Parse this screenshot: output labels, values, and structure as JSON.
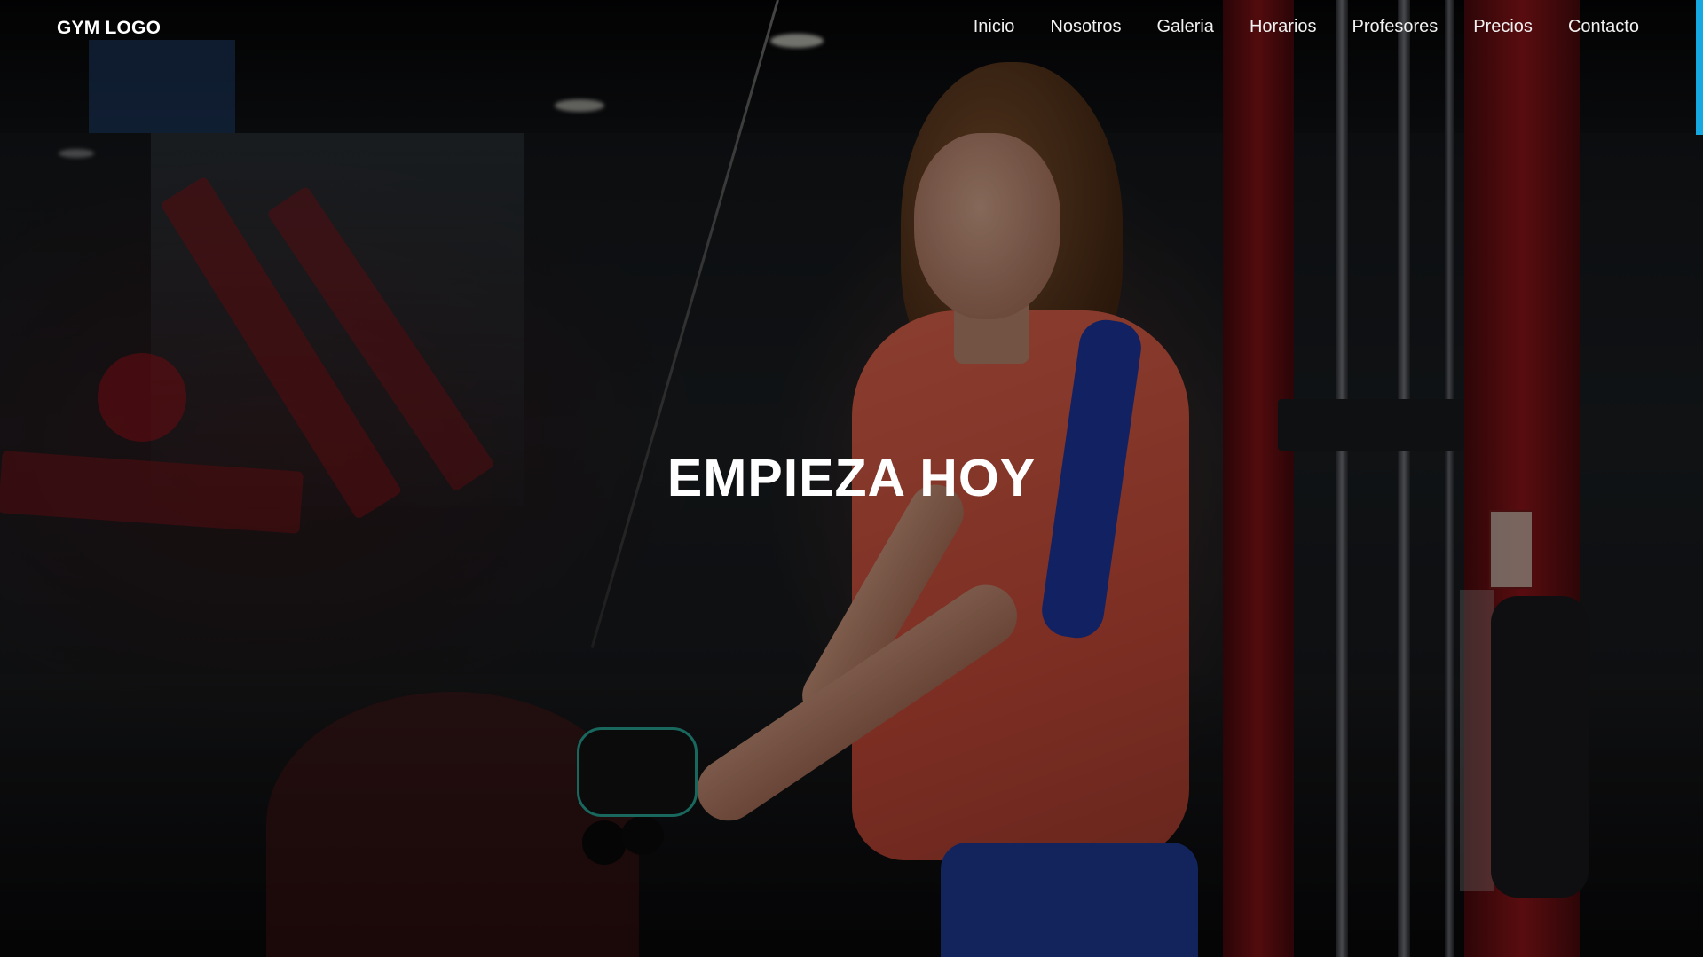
{
  "brand": {
    "logo_text": "GYM LOGO"
  },
  "nav": {
    "items": [
      {
        "label": "Inicio"
      },
      {
        "label": "Nosotros"
      },
      {
        "label": "Galeria"
      },
      {
        "label": "Horarios"
      },
      {
        "label": "Profesores"
      },
      {
        "label": "Precios"
      },
      {
        "label": "Contacto"
      }
    ]
  },
  "hero": {
    "headline": "EMPIEZA HOY",
    "background_image": "woman-training-cable-machine-gym-photo"
  },
  "colors": {
    "accent": "#16a8e0",
    "text": "#ffffff"
  }
}
